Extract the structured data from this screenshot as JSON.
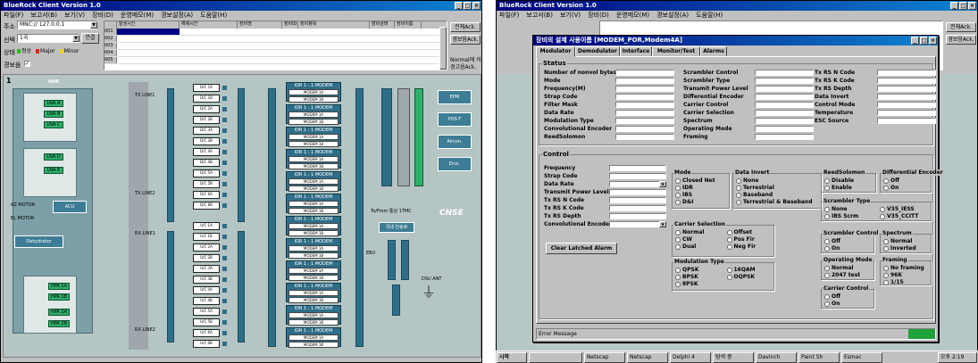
{
  "left": {
    "title": "BlueRock Client Version 1.0",
    "menu": [
      "파일(F)",
      "보고서(B)",
      "보기(V)",
      "장비(D)",
      "운영메모(M)",
      "경보설정(A)",
      "도움말(H)"
    ],
    "address_label": "주소",
    "address_value": "MNC:// 127.0.0.1",
    "select_label": "선택",
    "select_value": "1국",
    "connect_label": "연결",
    "state_label": "상태",
    "legend": [
      {
        "label": "정상",
        "color": "#20c020"
      },
      {
        "label": "Major",
        "color": "#e02020"
      },
      {
        "label": "Minor",
        "color": "#f0d020"
      }
    ],
    "alarm_sound_label": "경보음",
    "alarm_headers": [
      "발생시간",
      "해제시간",
      "장비명",
      "장비ID",
      "장비항목",
      "장비상태",
      "장비이름"
    ],
    "alarm_rows": [
      "001",
      "002",
      "003",
      "004",
      "005"
    ],
    "ack_all": "전체Ack.",
    "alarm_ack": "경보음Ack.",
    "normal_label": "Normal에 의",
    "alarm_clear_label": "경고음Ack.",
    "diagram": {
      "panel_number": "1",
      "hub_label": "HUB",
      "lna": [
        "LNA A",
        "LNA B",
        "LNA C",
        "LNA D",
        "LNA E"
      ],
      "hpa": [
        "HPA 1A",
        "HPA 1B",
        "HPA 2A",
        "HPA 2B"
      ],
      "tx_lines": [
        "TX LINE1",
        "TX LINE2"
      ],
      "rx_lines": [
        "RX LINE1",
        "RX LINE2"
      ],
      "dc_labels": [
        "D/C 1A",
        "D/C 1B",
        "D/C 2A",
        "D/C 2B",
        "D/C 3A",
        "D/C 3B",
        "D/C 4A",
        "D/C 4B",
        "D/C 5A",
        "D/C 5B",
        "D/C 6A",
        "D/C 6B"
      ],
      "uc_labels": [
        "U/C 1A",
        "U/C 1B",
        "U/C 2A",
        "U/C 2B",
        "U/C 3A",
        "U/C 3B",
        "U/C 4A",
        "U/C 4B",
        "U/C 5A",
        "U/C 5B",
        "U/C 6A",
        "U/C 6B"
      ],
      "idr": [
        "IDR 1 : 1 MODEM",
        "IDR 1 : 1 MODEM",
        "IDR 1 : 1 MODEM",
        "IDR 1 : 1 MODEM",
        "IDR 1 : 1 MODEM",
        "IDR 1 : 1 MODEM",
        "IDR 1 : 1 MODEM",
        "IDR 1 : 1 MODEM",
        "IDR 1 : 1 MODEM",
        "IDR 1 : 1 MODEM",
        "IDR 1 : 1 MODEM",
        "IDR 1 : 1 MODEM"
      ],
      "modem_sub": [
        "MODEM 1A",
        "MODEM 1B"
      ],
      "az_motor": "AZ MOTOR",
      "el_motor": "EL MOTOR",
      "acu": "ACU",
      "dehydrator": "Dehydrator",
      "side_buttons": [
        "EPM",
        "POS-T",
        "Aircon.",
        "Envi."
      ],
      "bus_labels": [
        "COMBINER",
        "DIVIDER",
        "COMBINER",
        "DIVIDER",
        "SWITCH MATRIX",
        "SWITCH MATRIX",
        "MUX"
      ],
      "to_from": "To/From 통상 1TMC",
      "mux_box": "국내 전송로",
      "ebu": "EBU",
      "ksat": "KSAT",
      "dsu_ant": "DSU ANT",
      "cnse_logo": "CNSE"
    }
  },
  "right": {
    "title": "BlueRock Client Version 1.0",
    "dialog_title": "장비의 설제 사용이름 [MODEM_POR,Modem4A]",
    "tabs": [
      "Modulator",
      "Demodulator",
      "Interface",
      "Monitor/Test",
      "Alarms"
    ],
    "status_title": "Status",
    "status_col1": [
      "Number of nonvol bytes",
      "Mode",
      "Frequency(M)",
      "Strap Code",
      "Filter Mask",
      "Data Rate",
      "Modulation Type",
      "Convolutional Encoder",
      "ReedSolomon"
    ],
    "status_col2": [
      "Scrambler Control",
      "Scrambler Type",
      "Transmit Power Level",
      "Differential Encoder",
      "Carrier Control",
      "Carrier Selection",
      "Spectrum",
      "Operating Mode",
      "Framing"
    ],
    "status_col3": [
      "Tx RS N Code",
      "Tx RS K Code",
      "Tx RS Depth",
      "Data Invert",
      "Control Mode",
      "Temperature",
      "ESC Source"
    ],
    "control_title": "Control",
    "control_fields": [
      "Frequency",
      "Strap Code",
      "Data Rate",
      "Transmit Power Level",
      "Tx RS N Code",
      "Tx RS K Code",
      "Tx RS Depth",
      "Convolutional Encoder"
    ],
    "clear_latched": "Clear Latched Alarm",
    "mode": {
      "title": "Mode",
      "options": [
        "Closed Net",
        "IDR",
        "IBS",
        "D&I"
      ]
    },
    "data_invert": {
      "title": "Data Invert",
      "options": [
        "None",
        "Terrestrial",
        "Baseband",
        "Terrestrial & Baseband"
      ]
    },
    "carrier_selection": {
      "title": "Carrier Selection",
      "options": [
        "Normal",
        "CW",
        "Dual",
        "Offset",
        "Pos Fir",
        "Neg Fir"
      ]
    },
    "modulation_type": {
      "title": "Modulation Type",
      "options": [
        "QPSK",
        "BPSK",
        "8PSK",
        "16QAM",
        "OQPSK"
      ]
    },
    "reed_solomon": {
      "title": "ReedSolomon",
      "options": [
        "Disable",
        "Enable"
      ]
    },
    "diff_encoder": {
      "title": "Differential Encoder",
      "options": [
        "Off",
        "On"
      ]
    },
    "scrambler_type": {
      "title": "Scrambler Type",
      "options": [
        "None",
        "IBS Scrm",
        "V35_IESS",
        "V35_CCITT"
      ]
    },
    "scrambler_control": {
      "title": "Scrambler Control",
      "options": [
        "Off",
        "On"
      ]
    },
    "spectrum": {
      "title": "Spectrum",
      "options": [
        "Normal",
        "Inverted"
      ]
    },
    "operating_mode": {
      "title": "Operating Mode",
      "options": [
        "Normal",
        "2047 test"
      ]
    },
    "framing": {
      "title": "Framing",
      "options": [
        "No framing",
        "96K",
        "1/15"
      ]
    },
    "carrier_control": {
      "title": "Carrier Control",
      "options": [
        "Off",
        "On"
      ]
    },
    "error_label": "Error Message",
    "taskbar": {
      "start": "시작",
      "items": [
        "Netscap",
        "Netscap",
        "Delphi 4",
        "탐색 중",
        "Davinch",
        "Paint Sh",
        "Esmac"
      ],
      "clock": "오후 2:19"
    }
  }
}
